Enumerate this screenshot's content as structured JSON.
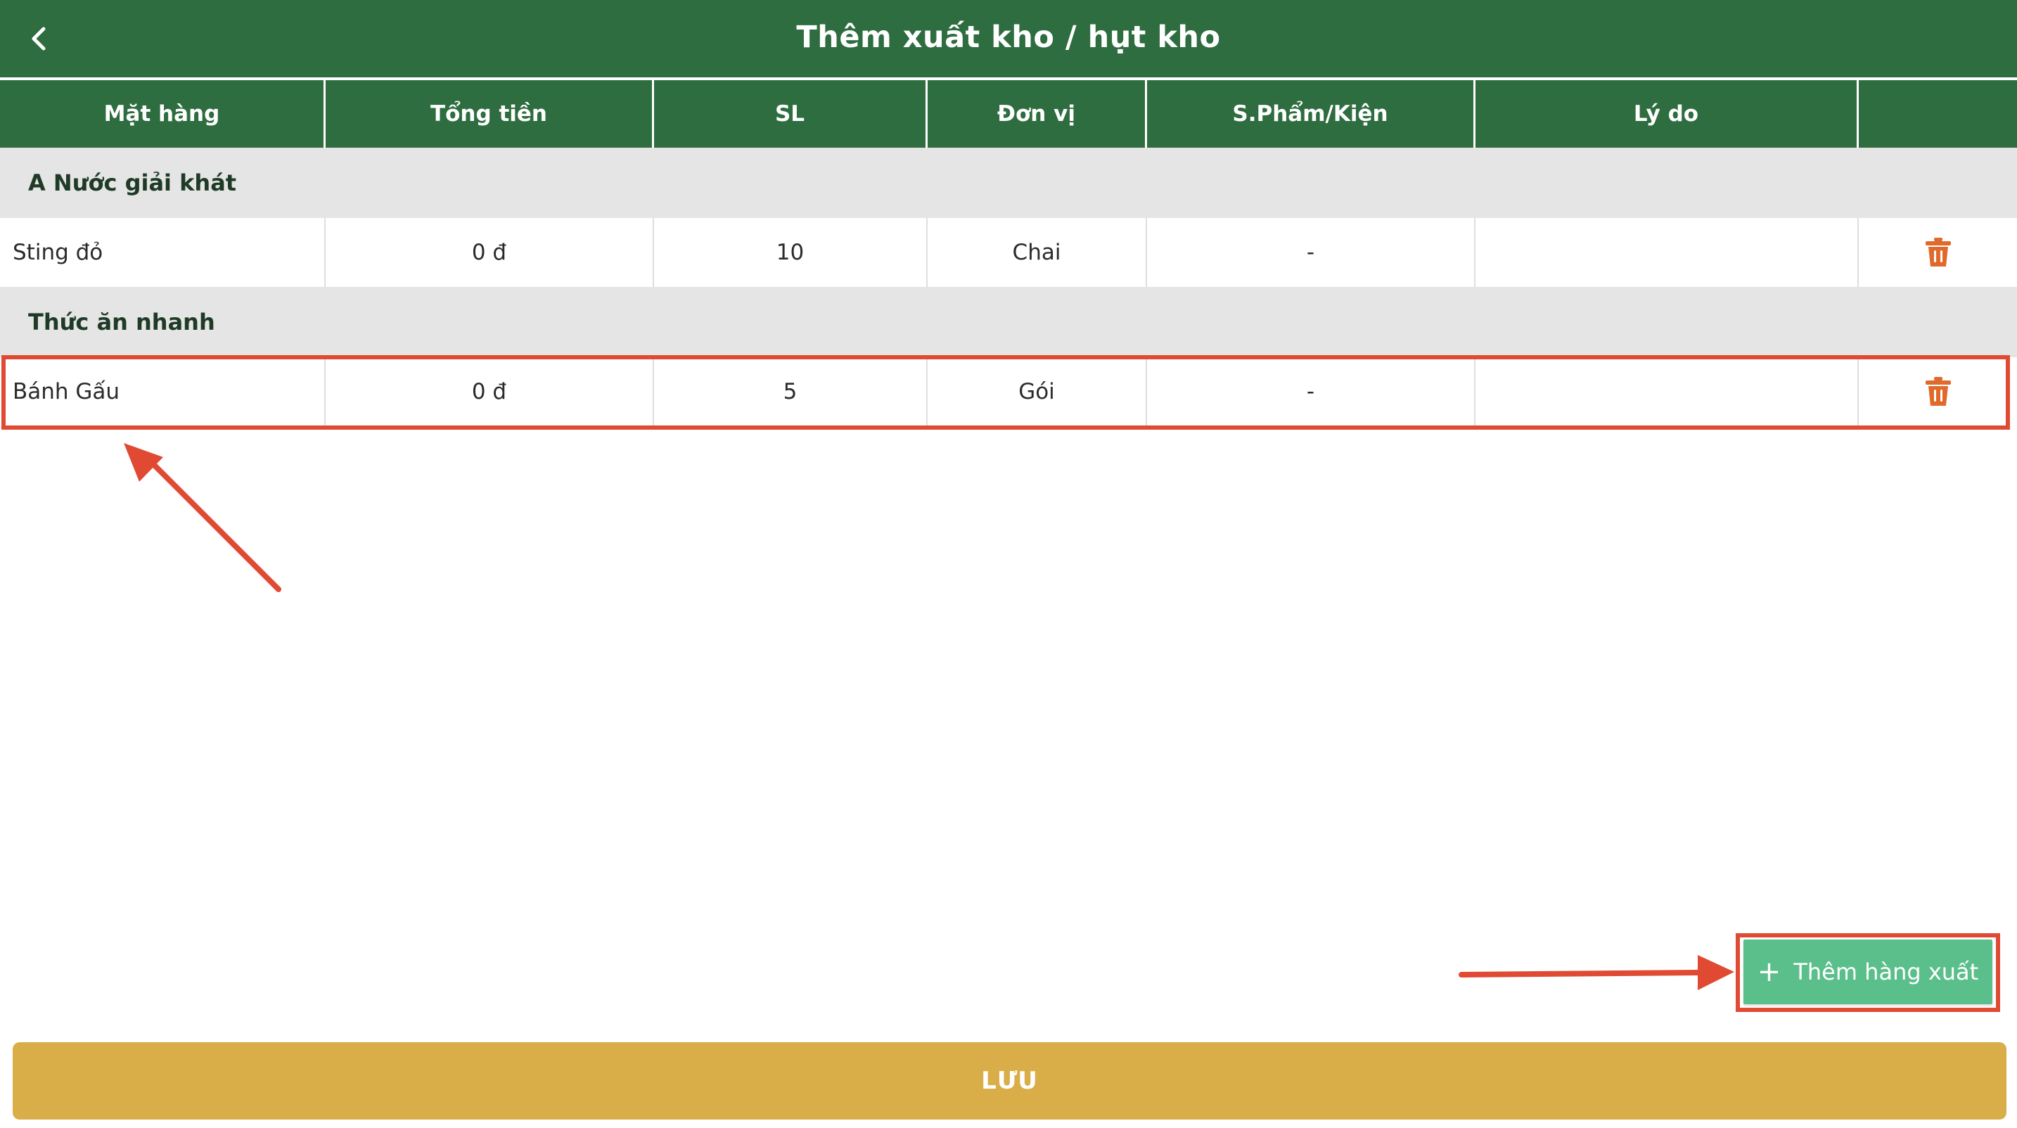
{
  "header": {
    "title": "Thêm xuất kho / hụt kho",
    "back_icon": "chevron-left-icon"
  },
  "table": {
    "columns": [
      "Mặt hàng",
      "Tổng tiền",
      "SL",
      "Đơn vị",
      "S.Phẩm/Kiện",
      "Lý do",
      ""
    ],
    "groups": [
      {
        "name": "A Nước giải khát",
        "rows": [
          {
            "item": "Sting đỏ",
            "total": "0 đ",
            "qty": "10",
            "unit": "Chai",
            "per_pack": "-",
            "reason": ""
          }
        ]
      },
      {
        "name": "Thức ăn nhanh",
        "rows": [
          {
            "item": "Bánh Gấu",
            "total": "0 đ",
            "qty": "5",
            "unit": "Gói",
            "per_pack": "-",
            "reason": ""
          }
        ]
      }
    ],
    "delete_icon": "trash-icon"
  },
  "add_button": {
    "label": "Thêm hàng xuất",
    "icon": "plus-icon"
  },
  "save_button": {
    "label": "LƯU"
  },
  "colors": {
    "header_bg": "#2e6d3f",
    "group_bg": "#e5e5e5",
    "delete_icon": "#e06a2b",
    "add_button_bg": "#5bbf8c",
    "save_button_bg": "#d9ae49",
    "annotation_red": "#e04a33"
  }
}
